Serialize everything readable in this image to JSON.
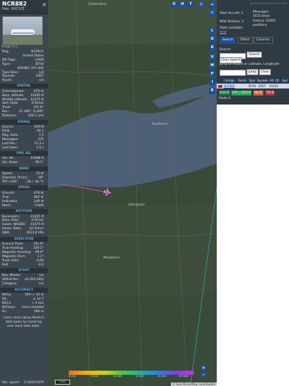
{
  "aircraft": {
    "callsign": "NCR882",
    "hex_label": "Hex: A9C52E",
    "close": "×",
    "image_credit": "Image © []"
  },
  "basic": [
    {
      "k": "Reg.:",
      "v": "N726CA"
    },
    {
      "k": "",
      "v": "United States"
    },
    {
      "k": "DB flags:",
      "v": "LADD"
    },
    {
      "k": "Type:",
      "v": "B744"
    },
    {
      "k": "",
      "v": "BOEING 747-400"
    },
    {
      "k": "Type Desc.:",
      "v": "L4J"
    },
    {
      "k": "Squawk:",
      "v": "2067"
    },
    {
      "k": "Route:",
      "v": "n/a"
    }
  ],
  "sections": [
    {
      "title": "SPATIAL",
      "rows": [
        {
          "k": "Groundspeed:",
          "v": "476 kt"
        },
        {
          "k": "Baro. altitude:",
          "v": "41025 ft"
        },
        {
          "k": "WGS84 altitude:",
          "v": "41475 ft"
        },
        {
          "k": "Vert. Rate:",
          "v": "0 ft/min"
        },
        {
          "k": "Track:",
          "v": "101.8°"
        },
        {
          "k": "Pos.:",
          "v": "51.399°, 0.499°"
        },
        {
          "k": "Distance:",
          "v": "226.1 nmi"
        }
      ]
    },
    {
      "title": "SIGNAL",
      "rows": [
        {
          "k": "Source:",
          "v": "ADS-B"
        },
        {
          "k": "RSSI:",
          "v": "-26.1"
        },
        {
          "k": "Msg. Rate:",
          "v": "7.5"
        },
        {
          "k": "Messages:",
          "v": "535"
        },
        {
          "k": "Last Pos.:",
          "v": "15.3 s"
        },
        {
          "k": "Last Seen:",
          "v": "1.6 s"
        }
      ]
    },
    {
      "title": "FMS SEL",
      "rows": [
        {
          "k": "Sel. Alt.:",
          "v": "41008 ft"
        },
        {
          "k": "Sel. Head.:",
          "v": "99.1°"
        }
      ]
    },
    {
      "title": "WIND",
      "rows": [
        {
          "k": "Speed:",
          "v": "15 kt"
        },
        {
          "k": "Direction (from):",
          "v": "38°"
        },
        {
          "k": "TAT / OAT:",
          "v": "-26 / -56 °C"
        }
      ]
    },
    {
      "title": "SPEED",
      "rows": [
        {
          "k": "Ground:",
          "v": "476 kt"
        },
        {
          "k": "True:",
          "v": "482 kt"
        },
        {
          "k": "Indicated:",
          "v": "249 kt"
        },
        {
          "k": "Mach:",
          "v": "0.840"
        }
      ]
    },
    {
      "title": "ALTITUDE",
      "rows": [
        {
          "k": "Barometric:",
          "v": "41025 ft"
        },
        {
          "k": "Baro. Rate:",
          "v": "0 ft/min"
        },
        {
          "k": "Geom. WGS84:",
          "v": "41475 ft"
        },
        {
          "k": "Geom. Rate:",
          "v": "-32 ft/min"
        },
        {
          "k": "QNH:",
          "v": "1013.6 hPa"
        }
      ]
    },
    {
      "title": "DIRECTION",
      "rows": [
        {
          "k": "Ground Track:",
          "v": "101.8°"
        },
        {
          "k": "True Heading:",
          "v": "100.1°"
        },
        {
          "k": "Magnetic Heading:",
          "v": "99.0°"
        },
        {
          "k": "Magnetic Decl.:",
          "v": "1.1°"
        },
        {
          "k": "Track Rate:",
          "v": "0.00"
        },
        {
          "k": "Roll:",
          "v": "-0.2"
        }
      ]
    },
    {
      "title": "STUFF",
      "rows": [
        {
          "k": "Nav. Modes:",
          "v": "n/a"
        },
        {
          "k": "ADS-B Ver.:",
          "v": "v0 (DO-260)"
        },
        {
          "k": "Category:",
          "v": "n/a"
        }
      ]
    },
    {
      "title": "ACCURACY",
      "rows": [
        {
          "k": "NACp:",
          "v": "EPU < 10 m"
        },
        {
          "k": "SIL:",
          "v": "≤ 1e-7"
        },
        {
          "k": "NACv:",
          "v": "< 3 m/s"
        },
        {
          "k": "NICbaro:",
          "v": "cross-checked"
        },
        {
          "k": "Rc:",
          "v": "186 m"
        }
      ]
    }
  ],
  "learn_more": "Learn more about Mode S data types by hovering over each data label.",
  "pos_epoch": {
    "k": "Pos. epoch:",
    "v": "1744221879"
  },
  "map": {
    "buttons": [
      "U",
      "H",
      "T"
    ],
    "side_buttons": [
      "L",
      "O",
      "K",
      "V",
      "M",
      "P",
      "I",
      "R"
    ],
    "labels": [
      "Chelmsford",
      "Southend",
      "Gillingham",
      "Maidstone"
    ],
    "scale": "2 km",
    "alt_ticks": [
      "6 000",
      "8 000",
      "10 000",
      "20 000",
      "30 000",
      "40 000+"
    ],
    "zoom_in": "+",
    "zoom_out": "−",
    "attribution": "© OpenStreetMap contributors"
  },
  "stats": {
    "link": "tar1090 on github (3.14.1725)",
    "total_label": "Total Aircraft: 1",
    "with_pos_label": "With Position: 1",
    "stats_label": "Stats available",
    "stats_link": "here",
    "messages_label": "Messages:",
    "messages_value": "1615.4/sec",
    "history_label": "History: 25091",
    "history_value": "positions"
  },
  "tabs": [
    "Search",
    "Filters",
    "Columns"
  ],
  "search": {
    "label": "Search:",
    "button": "Search",
    "clear_button": "Clear Search",
    "jump_label": "Jump to Airport or Latitude, Longitude:",
    "jump_button": "Jump",
    "clear_button2": "Clear"
  },
  "table": {
    "headers": [
      "Callsign",
      "Route",
      "Type",
      "Squawk",
      "Alt. (ft)",
      "Spd"
    ],
    "row": [
      "NCR882",
      "",
      "B744",
      "2067",
      "41025",
      ""
    ]
  },
  "sources": [
    "ADS-B",
    "UAT / ADS-R",
    "MLAT",
    "TIS-B"
  ],
  "mode_s": "Mode-S",
  "colors": {
    "panel_bg": "#3c4650",
    "section_title": "#5fb2e6",
    "accent_blue": "#1c4ea0",
    "track": "#d040e0",
    "water": "#4e6075",
    "land": "#3a4a38"
  }
}
